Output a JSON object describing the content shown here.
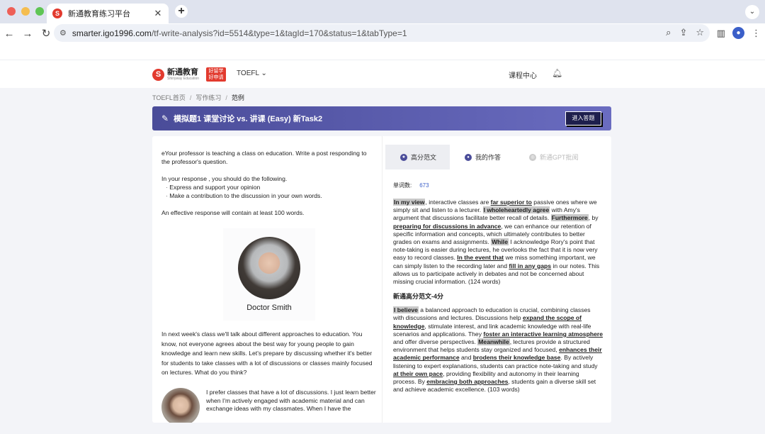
{
  "browser": {
    "tab_title": "新通教育练习平台",
    "url_host": "smarter.igo1996.com",
    "url_path": "/tf-write-analysis?id=5514&type=1&tagId=170&status=1&tabType=1"
  },
  "header": {
    "logo_text": "新通教育",
    "logo_sub": "Shinyway Education",
    "badge_text": "好留学 好申请",
    "nav_toefl": "TOEFL",
    "course_center": "课程中心"
  },
  "breadcrumb": [
    "TOEFL首页",
    "写作练习",
    "范例"
  ],
  "banner": {
    "title": "模拟题1 课堂讨论 vs. 讲课 (Easy) 新Task2",
    "enter_button": "进入答题"
  },
  "prompt": {
    "intro": "eYour professor is teaching a class on education. Write a post responding to the professor's question.",
    "response_lead": "In your response , you should do the following.",
    "bullets": [
      "Express and support your opinion",
      "Make a contribution to the discussion in your own words."
    ],
    "length_note": "An effective response will contain at least 100 words.",
    "professor_name": "Doctor Smith",
    "discussion": "In next week's class we'll talk about different approaches to education. You know, not everyone agrees about the best way for young people to gain knowledge and learn new skills. Let's prepare by discussing whether it's better for students to take classes with a lot of discussions or classes mainly focused on lectures. What do you think?",
    "student_post": "I prefer classes that have a lot of discussions. I just learn better when I'm actively engaged with academic material and can exchange ideas with my classmates. When I have the"
  },
  "answer_tabs": [
    "高分范文",
    "我的作答",
    "新通GPT批阅"
  ],
  "word_count_label": "单词数:",
  "word_count": "673",
  "essay1": [
    {
      "t": "In my view",
      "s": "hl"
    },
    {
      "t": ", interactive classes are "
    },
    {
      "t": "far superior to",
      "s": "u"
    },
    {
      "t": " passive ones where we simply sit and listen to a lecturer. "
    },
    {
      "t": "I wholeheartedly agree",
      "s": "hl"
    },
    {
      "t": " with Amy's argument that discussions facilitate better recall of details. "
    },
    {
      "t": "Furthermore",
      "s": "hl"
    },
    {
      "t": ", by "
    },
    {
      "t": "preparing for discussions in advance",
      "s": "u"
    },
    {
      "t": ", we can enhance our retention of specific information and concepts, which ultimately contributes to better grades on exams and assignments. "
    },
    {
      "t": "While",
      "s": "hl"
    },
    {
      "t": " I acknowledge Rory's point that note-taking is easier during lectures, he overlooks the fact that it is now very easy to record classes. "
    },
    {
      "t": "In the event that",
      "s": "u"
    },
    {
      "t": " we miss something important, we can simply listen to the recording later and "
    },
    {
      "t": "fill in any gaps",
      "s": "u"
    },
    {
      "t": " in our notes. This allows us to participate actively in debates and not be concerned about missing crucial information. (124 words)"
    }
  ],
  "essay2_heading": "新通高分范文-4分",
  "essay2": [
    {
      "t": "I believe",
      "s": "hl"
    },
    {
      "t": " a balanced approach to education is crucial, combining classes with discussions and lectures. Discussions help "
    },
    {
      "t": "expand the scope of knowledge",
      "s": "u"
    },
    {
      "t": ", stimulate interest, and link academic knowledge with real-life scenarios and applications. They "
    },
    {
      "t": "foster an interactive learning atmosphere",
      "s": "u"
    },
    {
      "t": " and offer diverse perspectives. "
    },
    {
      "t": "Meanwhile",
      "s": "hl"
    },
    {
      "t": ", lectures provide a structured environment that helps students stay organized and focused, "
    },
    {
      "t": "enhances their academic performance",
      "s": "u"
    },
    {
      "t": " and "
    },
    {
      "t": "brodens their knowledge base",
      "s": "u"
    },
    {
      "t": ". By actively listening to expert explanations, students can practice note-taking and study "
    },
    {
      "t": "at their own pace",
      "s": "u"
    },
    {
      "t": ", providing flexibility and autonomy in their learning process. By "
    },
    {
      "t": "embracing both approaches",
      "s": "u"
    },
    {
      "t": ", students gain a diverse skill set and achieve academic excellence. (103 words)"
    }
  ]
}
